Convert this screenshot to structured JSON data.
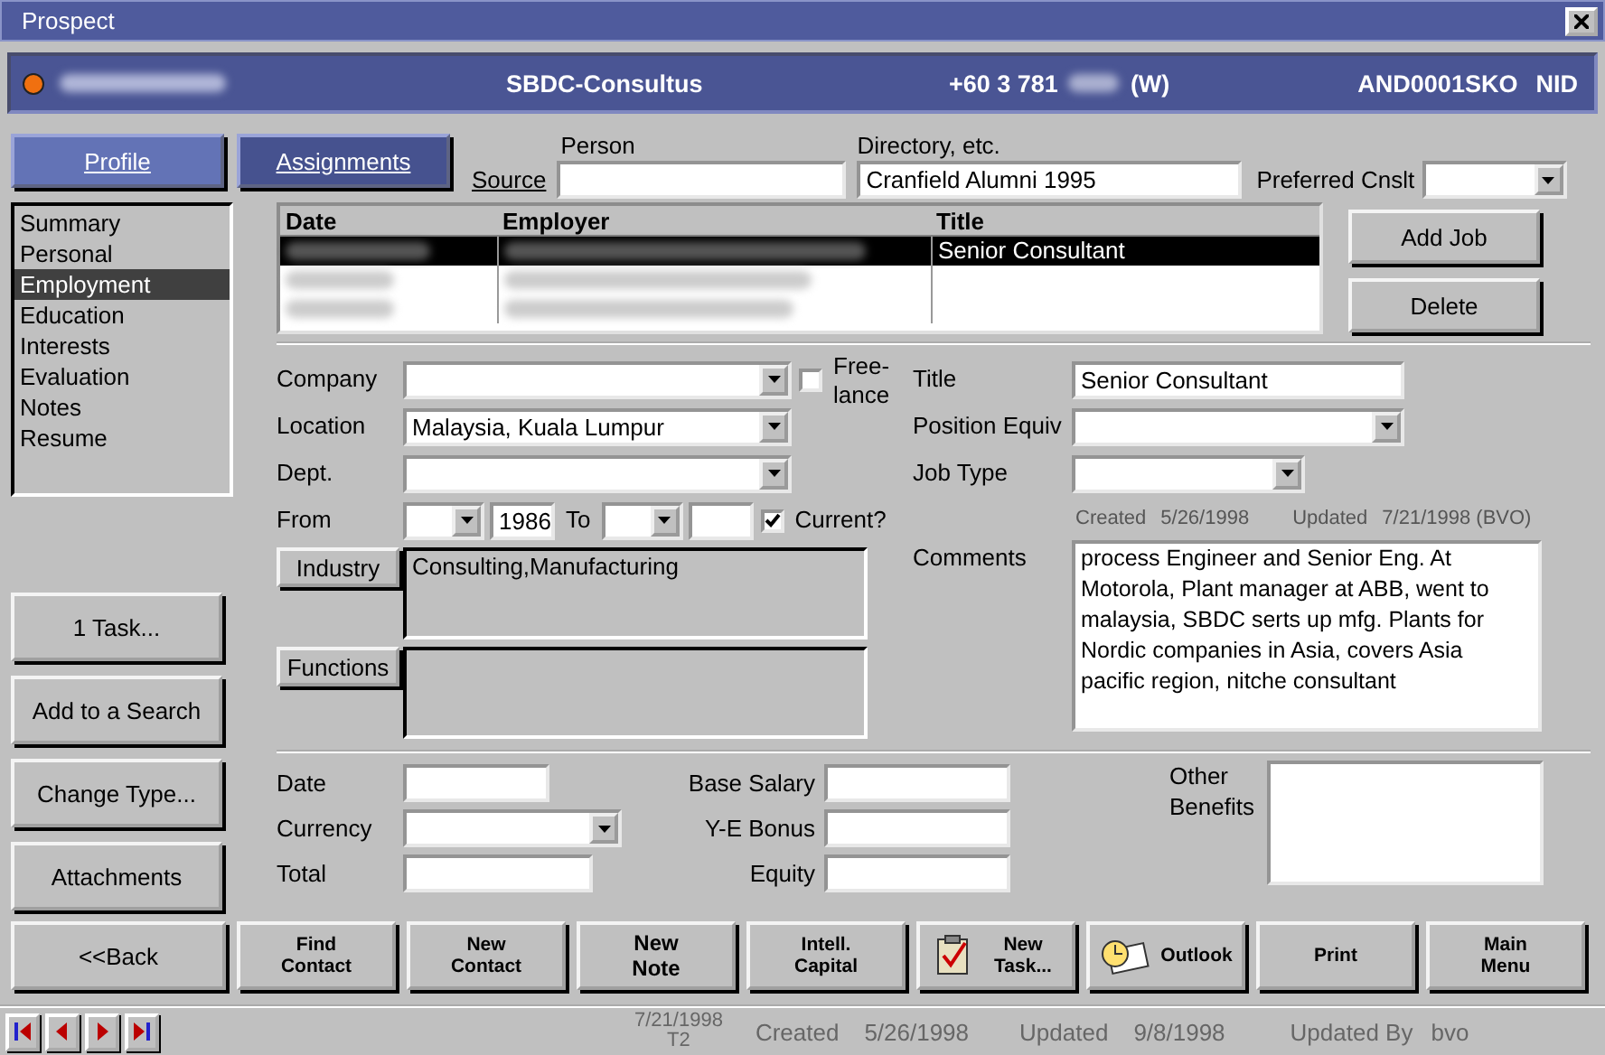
{
  "window": {
    "title": "Prospect"
  },
  "header": {
    "company": "SBDC-Consultus",
    "phone": "+60 3 781",
    "phone_type": "(W)",
    "code": "AND0001SKO",
    "status": "NID"
  },
  "view_tabs": [
    {
      "label": "Profile",
      "selected": true
    },
    {
      "label": "Assignments",
      "selected": false
    }
  ],
  "source": {
    "label": "Source",
    "person_label": "Person",
    "directory_label": "Directory, etc.",
    "directory": "Cranfield Alumni 1995",
    "preferred_label": "Preferred Cnslt"
  },
  "sections": [
    {
      "label": "Summary",
      "selected": false
    },
    {
      "label": "Personal",
      "selected": false
    },
    {
      "label": "Employment",
      "selected": true
    },
    {
      "label": "Education",
      "selected": false
    },
    {
      "label": "Interests",
      "selected": false
    },
    {
      "label": "Evaluation",
      "selected": false
    },
    {
      "label": "Notes",
      "selected": false
    },
    {
      "label": "Resume",
      "selected": false
    }
  ],
  "side_buttons": [
    "1 Task...",
    "Add to a Search",
    "Change Type...",
    "Attachments"
  ],
  "job_history": {
    "columns": [
      "Date",
      "Employer",
      "Title"
    ],
    "rows": [
      {
        "title": "Senior Consultant",
        "selected": true
      },
      {
        "selected": false
      },
      {
        "selected": false
      }
    ],
    "buttons": [
      "Add Job",
      "Delete"
    ]
  },
  "employment": {
    "company_label": "Company",
    "freelance": {
      "label": "Free-lance",
      "checked": false
    },
    "location_label": "Location",
    "location": "Malaysia, Kuala Lumpur",
    "dept_label": "Dept.",
    "from_label": "From",
    "from_year": "1986",
    "to_label": "To",
    "current": {
      "label": "Current?",
      "checked": true
    },
    "industry_button": "Industry",
    "industry": "Consulting,Manufacturing",
    "functions_button": "Functions",
    "title_label": "Title",
    "title": "Senior Consultant",
    "position_label": "Position Equiv",
    "job_type_label": "Job Type",
    "created_label": "Created",
    "created": "5/26/1998",
    "updated_label": "Updated",
    "updated": "7/21/1998 (BVO)",
    "comments_label": "Comments",
    "comments": "process Engineer and Senior Eng. At Motorola, Plant manager at ABB, went to malaysia, SBDC serts up mfg. Plants for Nordic companies in Asia, covers Asia pacific region, nitche consultant"
  },
  "compensation": {
    "date_label": "Date",
    "currency_label": "Currency",
    "total_label": "Total",
    "base_salary_label": "Base Salary",
    "bonus_label": "Y-E Bonus",
    "equity_label": "Equity",
    "other_benefits_label": "Other Benefits"
  },
  "toolbar": [
    {
      "label": "<<Back",
      "kind": "nav"
    },
    {
      "label": "Find Contact",
      "kind": "text"
    },
    {
      "label": "New Contact",
      "kind": "text"
    },
    {
      "label": "New Note",
      "kind": "note"
    },
    {
      "label": "Intell. Capital",
      "kind": "text"
    },
    {
      "label": "New Task...",
      "kind": "task"
    },
    {
      "label": "Outlook",
      "kind": "outlook"
    },
    {
      "label": "Print",
      "kind": "text"
    },
    {
      "label": "Main Menu",
      "kind": "text"
    }
  ],
  "status_bar": {
    "date": "7/21/1998",
    "terminal": "T2",
    "created_label": "Created",
    "created": "5/26/1998",
    "updated_label": "Updated",
    "updated": "9/8/1998",
    "updated_by_label": "Updated By",
    "updated_by": "bvo"
  }
}
